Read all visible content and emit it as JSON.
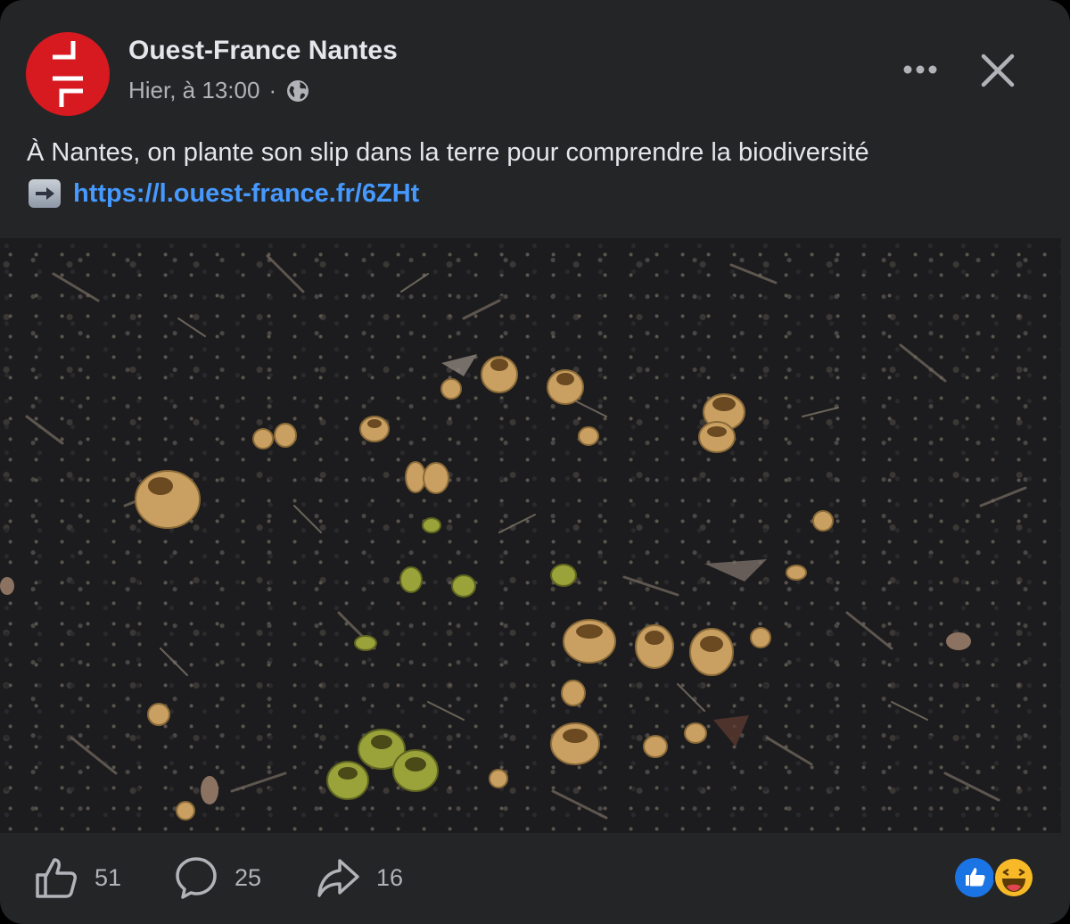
{
  "post": {
    "page_name": "Ouest-France Nantes",
    "timestamp": "Hier, à 13:00",
    "separator": "·",
    "audience_icon": "globe-icon",
    "text": "À Nantes, on plante son slip dans la terre pour comprendre la biodiversité",
    "link_emoji": "right-arrow-emoji",
    "link": "https://l.ouest-france.fr/6ZHt",
    "photo_description_icon": "photo"
  },
  "header": {
    "more_icon": "more-dots-icon",
    "close_icon": "close-icon"
  },
  "actions": {
    "like_count": "51",
    "comment_count": "25",
    "share_count": "16"
  },
  "reactions": [
    "like-reaction-icon",
    "haha-reaction-icon"
  ],
  "colors": {
    "card_bg": "#242526",
    "brand_red": "#d71920",
    "link_blue": "#4599ff",
    "text_primary": "#e4e6eb",
    "text_secondary": "#b0b3b8",
    "like_blue": "#1b74e4",
    "haha_yellow": "#f7b928"
  }
}
